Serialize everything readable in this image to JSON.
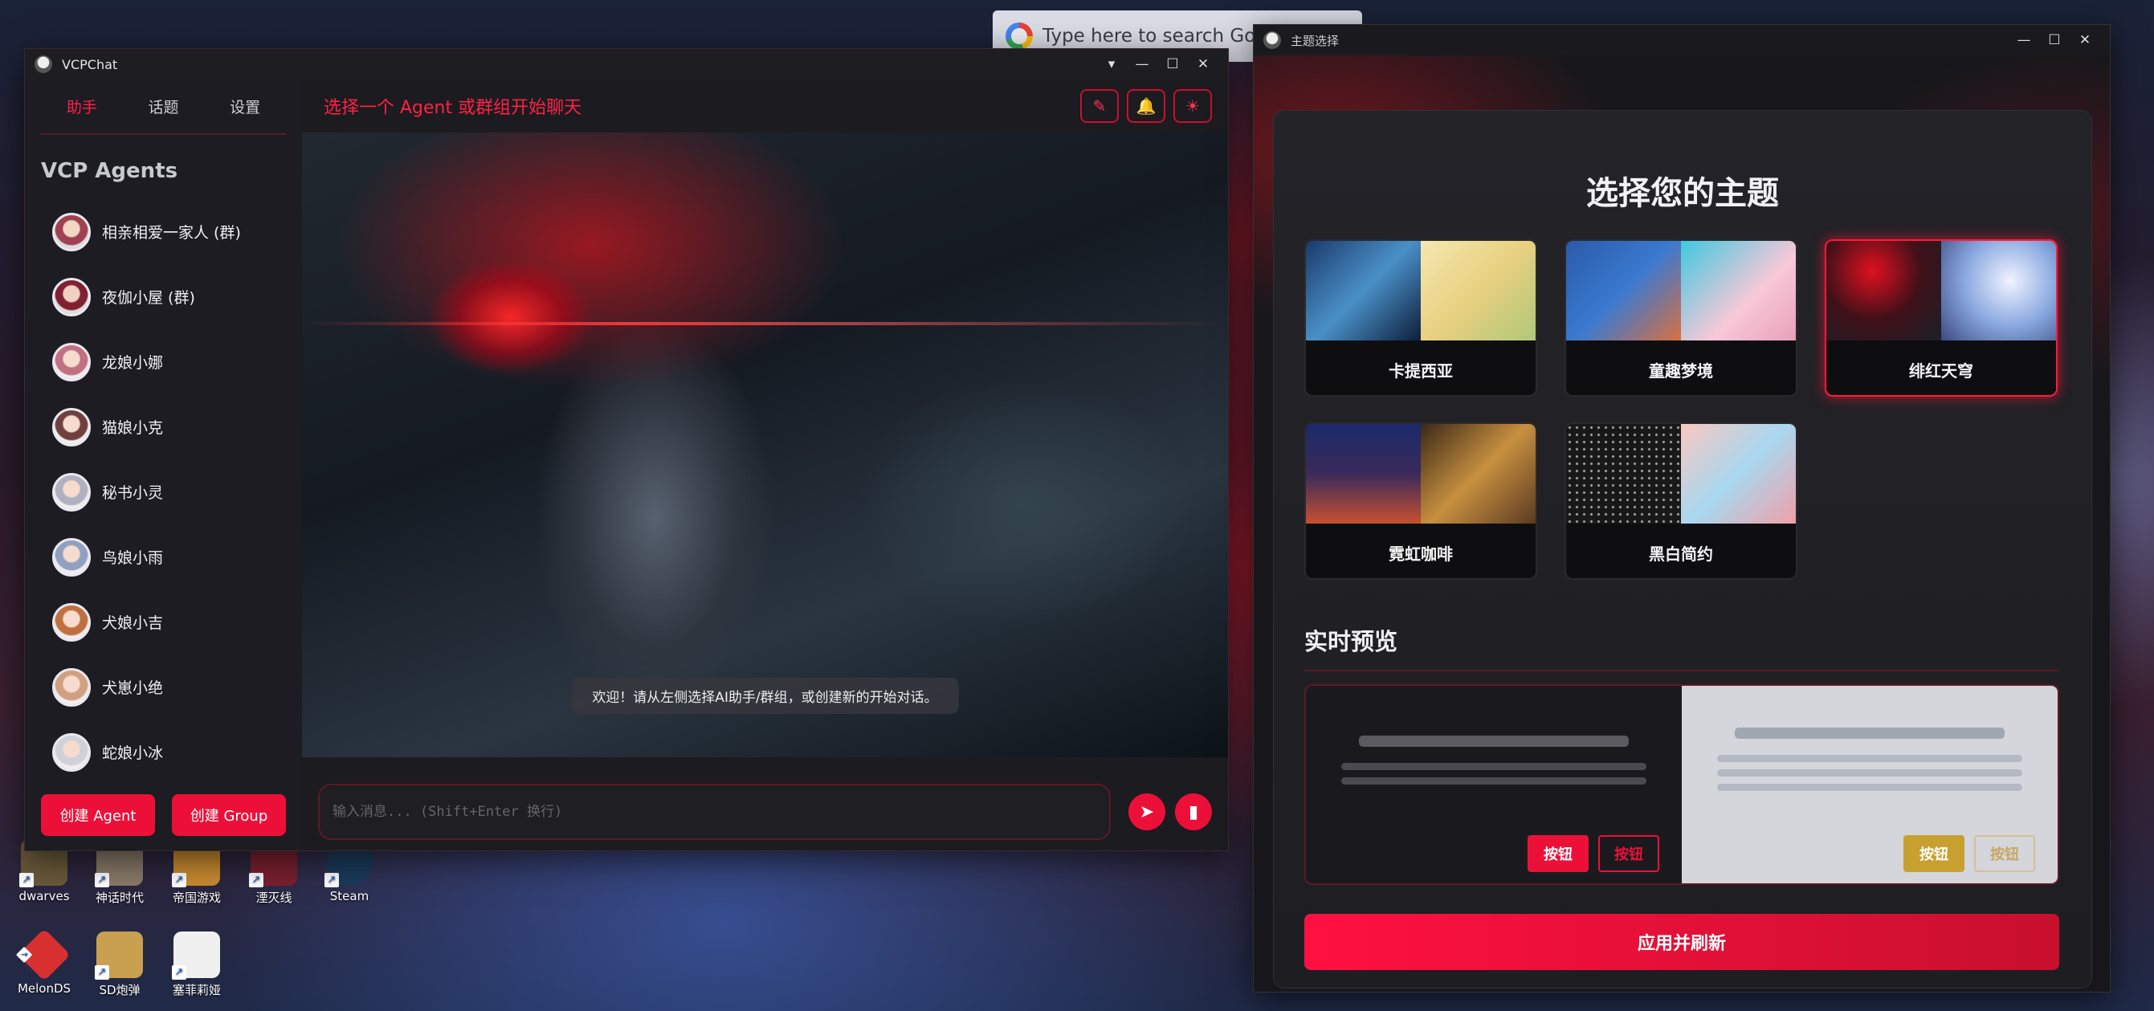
{
  "desktop": {
    "icons": [
      {
        "label": "dwarves",
        "color": "#6b5a3a"
      },
      {
        "label": "神话时代",
        "color": "#8a7a68"
      },
      {
        "label": "帝国游戏",
        "color": "#c88a30"
      },
      {
        "label": "湮灭线",
        "color": "#7a2030"
      },
      {
        "label": "Steam",
        "color": "#1a3a5a"
      },
      {
        "label": "MelonDS",
        "color": "#d83030"
      },
      {
        "label": "SD炮弹",
        "color": "#c8a050"
      },
      {
        "label": "塞菲莉娅",
        "color": "#f0f0f0"
      }
    ],
    "google_search_placeholder": "Type here to search Google"
  },
  "chat_window": {
    "title": "VCPChat",
    "tabs": [
      "助手",
      "话题",
      "设置"
    ],
    "active_tab": "助手",
    "sidebar_heading": "VCP Agents",
    "agents": [
      {
        "name": "相亲相爱一家人 (群)"
      },
      {
        "name": "夜伽小屋 (群)"
      },
      {
        "name": "龙娘小娜"
      },
      {
        "name": "猫娘小克"
      },
      {
        "name": "秘书小灵"
      },
      {
        "name": "鸟娘小雨"
      },
      {
        "name": "犬娘小吉"
      },
      {
        "name": "犬崽小绝"
      },
      {
        "name": "蛇娘小冰"
      }
    ],
    "create_agent_label": "创建 Agent",
    "create_group_label": "创建 Group",
    "header_title": "选择一个 Agent 或群组开始聊天",
    "header_buttons": [
      "notes-icon",
      "bell-icon",
      "sun-icon"
    ],
    "welcome_message": "欢迎！请从左侧选择AI助手/群组，或创建新的开始对话。",
    "input_placeholder": "输入消息... (Shift+Enter 换行)"
  },
  "theme_window": {
    "title": "主题选择",
    "heading": "选择您的主题",
    "themes": [
      {
        "name": "卡提西亚",
        "selected": false
      },
      {
        "name": "童趣梦境",
        "selected": false
      },
      {
        "name": "绯红天穹",
        "selected": true
      },
      {
        "name": "霓虹咖啡",
        "selected": false
      },
      {
        "name": "黑白简约",
        "selected": false
      }
    ],
    "preview_heading": "实时预览",
    "preview_button_label": "按钮",
    "apply_label": "应用并刷新",
    "accent_color": "#ec1038"
  }
}
